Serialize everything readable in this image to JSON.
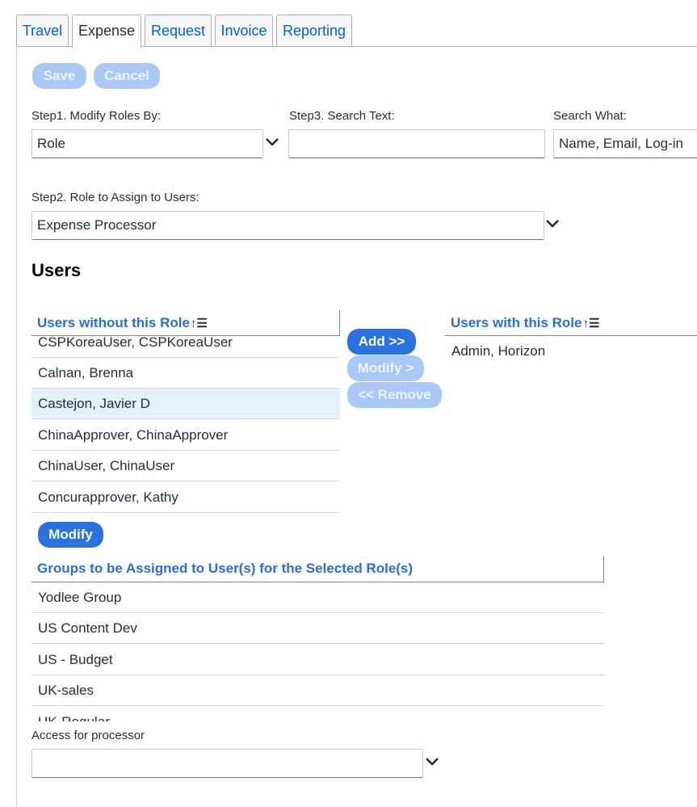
{
  "tabs": [
    {
      "label": "Travel",
      "active": false
    },
    {
      "label": "Expense",
      "active": true
    },
    {
      "label": "Request",
      "active": false
    },
    {
      "label": "Invoice",
      "active": false
    },
    {
      "label": "Reporting",
      "active": false
    }
  ],
  "toolbar": {
    "save_label": "Save",
    "cancel_label": "Cancel"
  },
  "step1": {
    "label": "Step1. Modify Roles By:",
    "value": "Role"
  },
  "step3": {
    "label": "Step3. Search Text:",
    "value": ""
  },
  "search_what": {
    "label": "Search What:",
    "value": "Name, Email, Log-in"
  },
  "step2": {
    "label": "Step2. Role to Assign to Users:",
    "value": "Expense Processor"
  },
  "users_heading": "Users",
  "users_without": {
    "header": "Users without this Role",
    "rows": [
      "CSPKoreaUser, CSPKoreaUser",
      "Calnan, Brenna",
      "Castejon, Javier D",
      "ChinaApprover, ChinaApprover",
      "ChinaUser, ChinaUser",
      "Concurapprover, Kathy"
    ],
    "selected_index": 2
  },
  "transfer": {
    "add_label": "Add >>",
    "modify_label": "Modify >",
    "remove_label": "<< Remove"
  },
  "users_with": {
    "header": "Users with this Role",
    "rows": [
      "Admin, Horizon"
    ]
  },
  "modify_label": "Modify",
  "groups": {
    "header": "Groups to be Assigned to User(s) for the Selected Role(s)",
    "rows": [
      "Yodlee Group",
      "US Content Dev",
      "US - Budget",
      "UK-sales",
      "UK-Regular"
    ]
  },
  "access": {
    "label": "Access for processor",
    "value": ""
  },
  "icons": {
    "sort": "sort-ascending-icon",
    "dropdown": "chevron-down-icon"
  },
  "colors": {
    "accent": "#2a72e0",
    "link": "#2a6dd4",
    "disabled": "#a9c8f5",
    "selected_row": "#e3f1fb"
  }
}
